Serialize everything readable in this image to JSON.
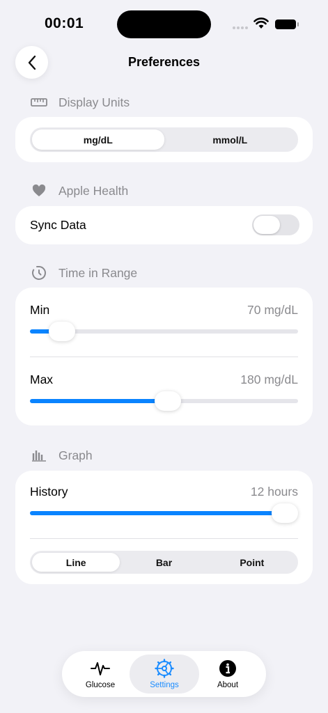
{
  "status_bar": {
    "time": "00:01"
  },
  "header": {
    "title": "Preferences"
  },
  "display_units": {
    "header": "Display Units",
    "options": [
      "mg/dL",
      "mmol/L"
    ],
    "selected": "mg/dL"
  },
  "apple_health": {
    "header": "Apple Health",
    "sync_label": "Sync Data",
    "sync_enabled": false
  },
  "time_in_range": {
    "header": "Time in Range",
    "min": {
      "label": "Min",
      "value": "70 mg/dL"
    },
    "max": {
      "label": "Max",
      "value": "180 mg/dL"
    }
  },
  "graph": {
    "header": "Graph",
    "history": {
      "label": "History",
      "value": "12 hours"
    },
    "style_options": [
      "Line",
      "Bar",
      "Point"
    ],
    "selected_style": "Line"
  },
  "tab_bar": {
    "items": [
      {
        "label": "Glucose",
        "icon": "waveform-icon"
      },
      {
        "label": "Settings",
        "icon": "gear-icon"
      },
      {
        "label": "About",
        "icon": "info-icon"
      }
    ],
    "active": "Settings"
  },
  "colors": {
    "accent": "#0a84ff",
    "background": "#f2f2f7",
    "secondary_text": "#8a8a8e"
  }
}
